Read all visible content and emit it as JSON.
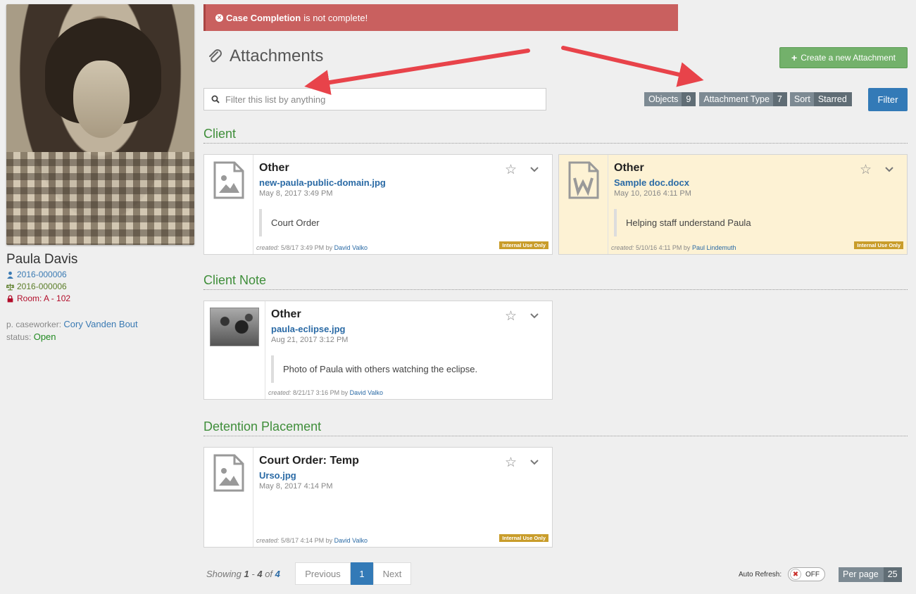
{
  "profile": {
    "name": "Paula Davis",
    "client_id": "2016-000006",
    "case_id": "2016-000006",
    "room": "Room: A - 102",
    "caseworker_label": "p. caseworker:",
    "caseworker": "Cory Vanden Bout",
    "status_label": "status:",
    "status": "Open"
  },
  "alert": {
    "bold": "Case Completion",
    "text": "is not complete!"
  },
  "page": {
    "title": "Attachments",
    "create_label": "Create a new Attachment"
  },
  "filter": {
    "placeholder": "Filter this list by anything",
    "button": "Filter",
    "chips": [
      {
        "key": "Objects",
        "value": "9"
      },
      {
        "key": "Attachment Type",
        "value": "7"
      },
      {
        "key": "Sort",
        "value": "Starred"
      }
    ]
  },
  "sections": {
    "client": "Client",
    "client_note": "Client Note",
    "detention": "Detention Placement"
  },
  "cards": [
    {
      "type": "Other",
      "file": "new-paula-public-domain.jpg",
      "date": "May 8, 2017 3:49 PM",
      "note": "Court Order",
      "created_label": "created:",
      "created": "5/8/17 3:49 PM by",
      "author": "David Valko",
      "badge": "Internal Use Only"
    },
    {
      "type": "Other",
      "file": "Sample doc.docx",
      "date": "May 10, 2016 4:11 PM",
      "note": "Helping staff understand Paula",
      "created_label": "created:",
      "created": "5/10/16 4:11 PM by",
      "author": "Paul Lindemuth",
      "badge": "Internal Use Only"
    },
    {
      "type": "Other",
      "file": "paula-eclipse.jpg",
      "date": "Aug 21, 2017 3:12 PM",
      "note": "Photo of Paula with others watching the eclipse.",
      "created_label": "created:",
      "created": "8/21/17 3:16 PM by",
      "author": "David Valko"
    },
    {
      "type": "Court Order: Temp",
      "file": "Urso.jpg",
      "date": "May 8, 2017 4:14 PM",
      "created_label": "created:",
      "created": "5/8/17 4:14 PM by",
      "author": "David Valko",
      "badge": "Internal Use Only"
    }
  ],
  "pagination": {
    "showing": "Showing",
    "from": "1",
    "dash": "-",
    "to": "4",
    "of": "of",
    "total": "4",
    "prev": "Previous",
    "current": "1",
    "next": "Next",
    "auto_refresh": "Auto Refresh:",
    "toggle": "OFF",
    "per_page_label": "Per page",
    "per_page": "25"
  },
  "colors": {
    "accent": "#337ab7",
    "success": "#73b16b",
    "danger": "#c9605f",
    "section": "#3f8e3a",
    "badge": "#c99d2b",
    "arrow": "#e8434a"
  }
}
